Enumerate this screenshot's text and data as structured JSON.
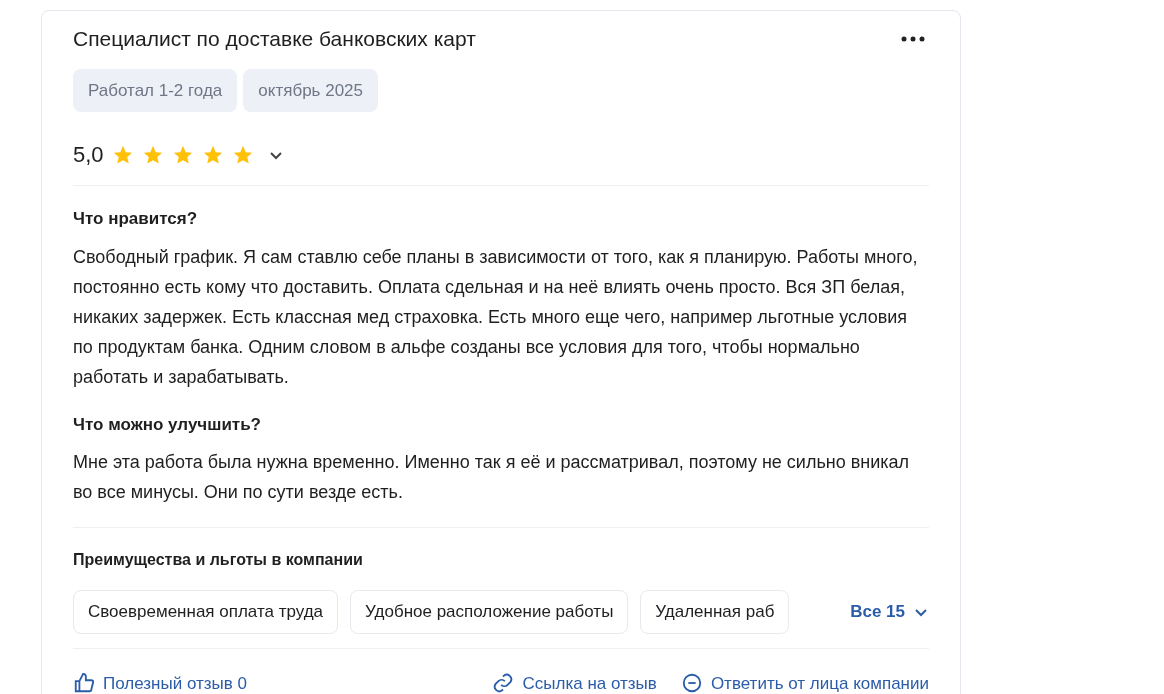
{
  "review": {
    "title": "Специалист по доставке банковских карт",
    "tags": [
      "Работал 1-2 года",
      "октябрь 2025"
    ],
    "rating": {
      "value": "5,0",
      "stars": 5,
      "expanded": false
    },
    "sections": [
      {
        "heading": "Что нравится?",
        "text": "Свободный график. Я сам ставлю себе планы в зависимости от того, как я планирую. Работы много, постоянно есть кому что доставить. Оплата сдельная и на неё влиять очень просто. Вся ЗП белая, никаких задержек. Есть классная мед страховка. Есть много еще чего, например льготные условия по продуктам банка. Одним словом в альфе созданы все условия для того, чтобы нормально работать и зарабатывать."
      },
      {
        "heading": "Что можно улучшить?",
        "text": "Мне эта работа была нужна временно. Именно так я её и рассматривал, поэтому не сильно вникал во все минусы. Они по сути везде есть."
      }
    ],
    "benefits": {
      "heading": "Преимущества и льготы в компании",
      "items": [
        "Своевременная оплата труда",
        "Удобное расположение работы",
        "Удаленная раб"
      ],
      "more": "Все 15",
      "expanded": false
    },
    "actions": [
      {
        "kind": "like",
        "label": "Полезный отзыв 0"
      },
      {
        "kind": "link",
        "label": "Ссылка на отзыв"
      },
      {
        "kind": "reply",
        "label": "Ответить от лица компании"
      }
    ]
  }
}
